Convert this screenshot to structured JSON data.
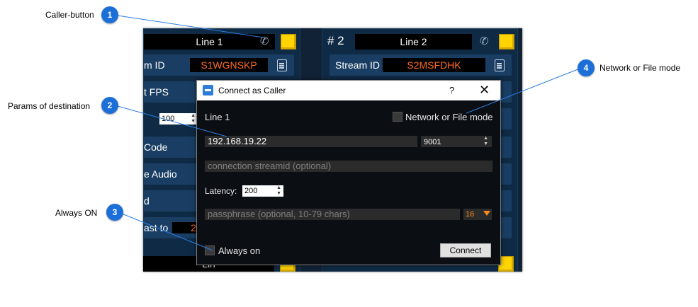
{
  "background_app": {
    "panel1": {
      "title": "Line 1",
      "stream_label": "m ID",
      "stream_value": "S1WGNSKP",
      "row_fps": "t FPS",
      "spin_value": "100",
      "row_code": "Code",
      "row_audio": "e Audio",
      "row_d": "d",
      "row_cast": "ast to",
      "cast_value": "2",
      "bottom_title": "Lin"
    },
    "panel2": {
      "hash": "# 2",
      "title": "Line 2",
      "stream_label": "Stream ID",
      "stream_value": "S2MSFDHK"
    }
  },
  "dialog": {
    "title": "Connect as Caller",
    "help": "?",
    "close": "✕",
    "line_label": "Line 1",
    "network_mode_label": "Network or File mode",
    "address_value": "192.168.19.22",
    "port_value": "9001",
    "streamid_placeholder": "connection streamid (optional)",
    "latency_label": "Latency:",
    "latency_value": "200",
    "passphrase_placeholder": "passphrase (optional, 10-79 chars)",
    "key_length": "16",
    "always_on_label": "Always on",
    "connect_label": "Connect"
  },
  "annotations": [
    {
      "num": "1",
      "label": "Caller-button"
    },
    {
      "num": "2",
      "label": "Params of destination"
    },
    {
      "num": "3",
      "label": "Always ON"
    },
    {
      "num": "4",
      "label": "Network or File mode"
    }
  ],
  "colors": {
    "badge": "#1d6fd8",
    "dialog_bg": "#0b0f14",
    "panel_bg": "#0f2a44",
    "accent_yellow": "#ffd400",
    "stream_orange": "#ff6a1a"
  }
}
